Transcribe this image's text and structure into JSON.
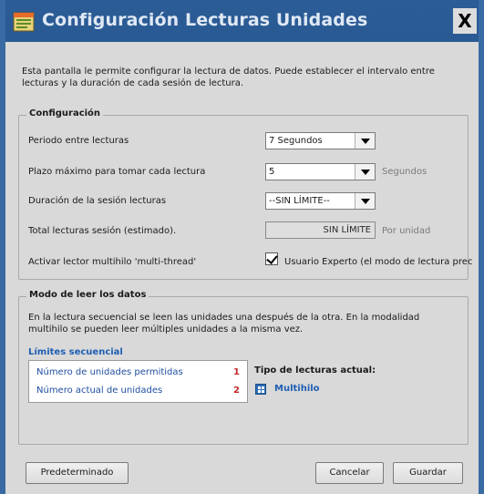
{
  "window": {
    "title": "Configuración Lecturas Unidades",
    "close_label": "X"
  },
  "intro": "Esta pantalla le permite configurar la lectura de datos. Puede establecer el intervalo entre lecturas y la duración de cada sesión de lectura.",
  "config": {
    "legend": "Configuración",
    "rows": [
      {
        "label": "Periodo entre lecturas",
        "value": "7 Segundos"
      },
      {
        "label": "Plazo máximo para tomar cada lectura",
        "value": "5",
        "unit": "Segundos"
      },
      {
        "label": "Duración de la sesión lecturas",
        "value": "--SIN LÍMITE--"
      },
      {
        "label": "Total lecturas sesión (estimado).",
        "value": "SIN LÍMITE",
        "unit": "Por unidad"
      },
      {
        "label": "Activar lector multihilo 'multi-thread'",
        "checkbox_label": "Usuario Experto (el modo de lectura prec",
        "checked": true
      }
    ]
  },
  "mode": {
    "legend": "Modo de leer los datos",
    "description": "En la lectura secuencial se leen las unidades una después de la otra. En la modalidad multihilo se pueden leer múltiples unidades a la misma vez.",
    "limits_title": "Límites secuencial",
    "limits": [
      {
        "label": "Número de unidades permitidas",
        "value": "1"
      },
      {
        "label": "Número actual de unidades",
        "value": "2"
      }
    ],
    "current_type_title": "Tipo de lecturas actual:",
    "current_type_value": "Multihilo"
  },
  "buttons": {
    "default": "Predeterminado",
    "cancel": "Cancelar",
    "save": "Guardar"
  },
  "colors": {
    "title_bar": "#2c5c96",
    "link_blue": "#1f5fb3",
    "count_red": "#c0282a"
  }
}
